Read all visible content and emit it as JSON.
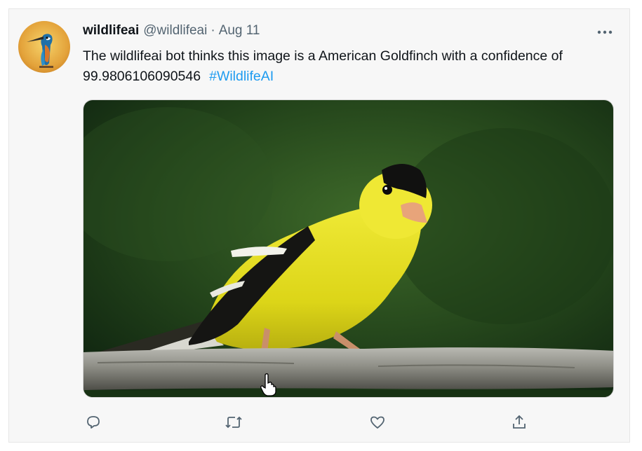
{
  "tweet": {
    "display_name": "wildlifeai",
    "handle": "@wildlifeai",
    "separator": "·",
    "date": "Aug 11",
    "text": "The wildlifeai bot thinks this image is a American Goldfinch with a confidence of 99.9806106090546",
    "hashtag": "#WildlifeAI",
    "more_icon": "more-horizontal-icon",
    "media_subject": "American Goldfinch photo"
  },
  "actions": [
    {
      "name": "reply",
      "icon": "reply-icon"
    },
    {
      "name": "retweet",
      "icon": "retweet-icon"
    },
    {
      "name": "like",
      "icon": "heart-icon"
    },
    {
      "name": "share",
      "icon": "share-icon"
    }
  ],
  "colors": {
    "link": "#1d9bf0",
    "secondary_text": "#536471",
    "icon": "#536471",
    "background": "#f7f7f7"
  }
}
